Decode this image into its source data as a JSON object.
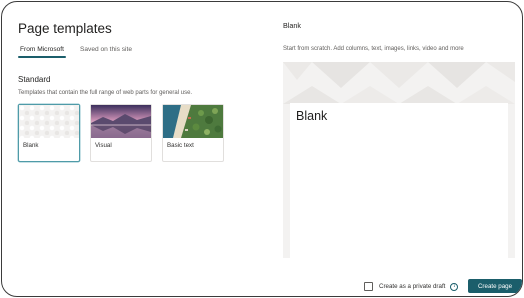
{
  "dialog": {
    "title": "Page templates",
    "tabs": [
      {
        "label": "From Microsoft",
        "active": true
      },
      {
        "label": "Saved on this site",
        "active": false
      }
    ],
    "section": {
      "title": "Standard",
      "description": "Templates that contain the full range of web parts for general use."
    },
    "templates": [
      {
        "label": "Blank",
        "thumbnail": "pattern-thumbnail",
        "selected": true
      },
      {
        "label": "Visual",
        "thumbnail": "mountain-lake-thumbnail",
        "selected": false
      },
      {
        "label": "Basic text",
        "thumbnail": "aerial-coast-thumbnail",
        "selected": false
      }
    ]
  },
  "preview": {
    "title": "Blank",
    "description": "Start from scratch. Add columns, text, images, links, video and more",
    "page_title": "Blank"
  },
  "footer": {
    "private_draft_label": "Create as a private draft",
    "private_draft_checked": false,
    "info_icon": "info-icon",
    "create_button_label": "Create page"
  },
  "colors": {
    "accent": "#1b5e6b",
    "selected_border": "#4f9ba8",
    "frame_border": "#3b3b3b"
  }
}
